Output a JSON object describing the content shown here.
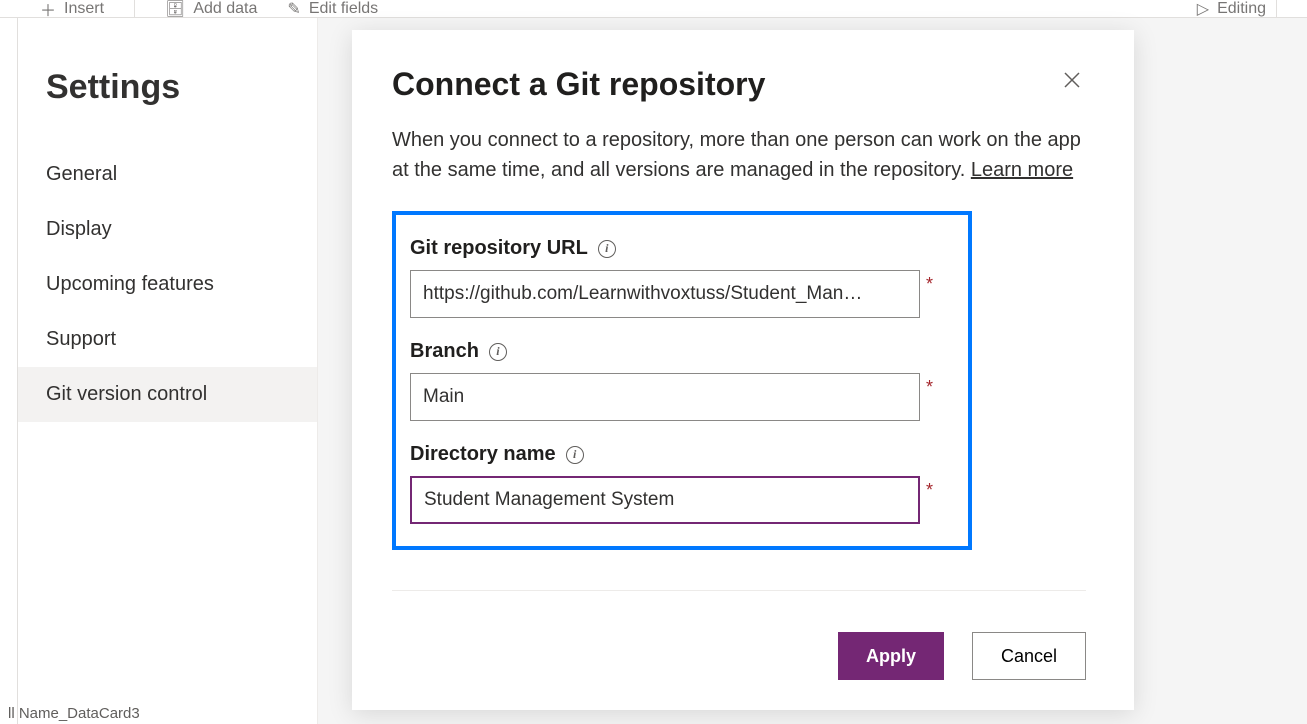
{
  "toolbar": {
    "insert": "Insert",
    "add_data": "Add data",
    "edit_fields": "Edit fields",
    "editing": "Editing"
  },
  "settings": {
    "title": "Settings",
    "items": [
      {
        "label": "General"
      },
      {
        "label": "Display"
      },
      {
        "label": "Upcoming features"
      },
      {
        "label": "Support"
      },
      {
        "label": "Git version control"
      }
    ],
    "active_index": 4
  },
  "modal": {
    "title": "Connect a Git repository",
    "description": "When you connect to a repository, more than one person can work on the app at the same time, and all versions are managed in the repository.",
    "learn_more": "Learn more",
    "fields": {
      "url_label": "Git repository URL",
      "url_value": "https://github.com/Learnwithvoxtuss/Student_Man…",
      "branch_label": "Branch",
      "branch_value": "Main",
      "dir_label": "Directory name",
      "dir_value": "Student Management System"
    },
    "buttons": {
      "apply": "Apply",
      "cancel": "Cancel"
    }
  },
  "status": "ll Name_DataCard3"
}
